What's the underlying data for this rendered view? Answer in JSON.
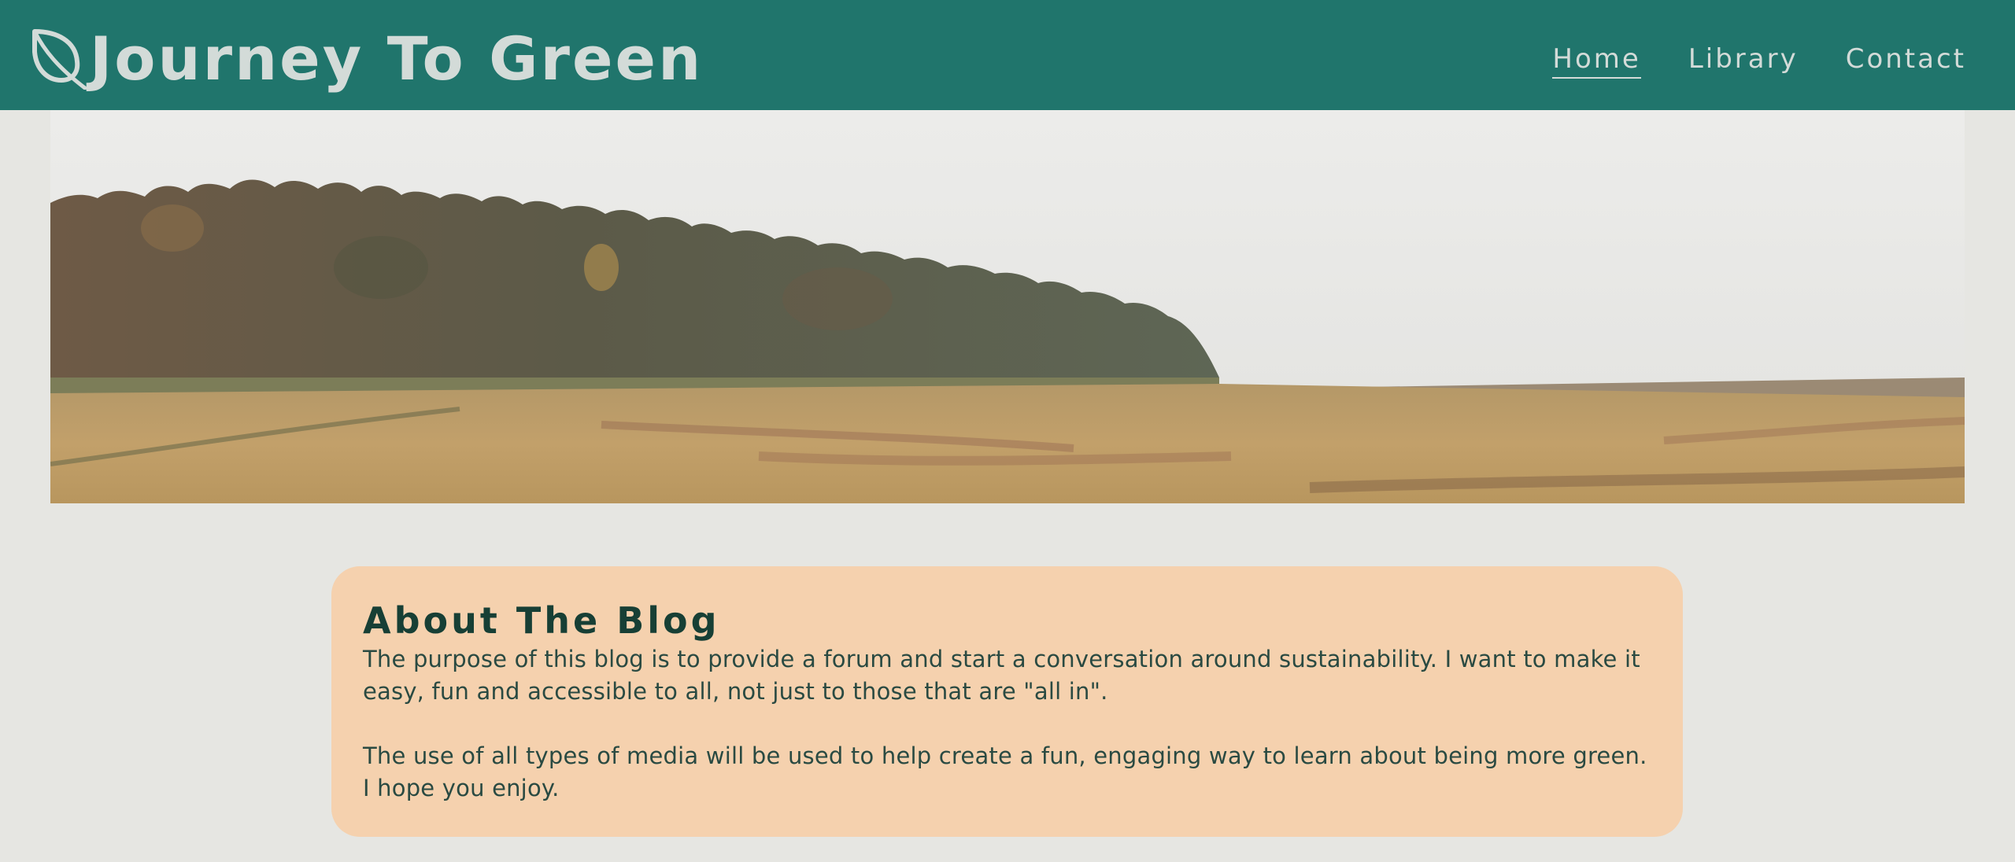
{
  "header": {
    "logo_icon": "leaf-icon",
    "title": "Journey To Green",
    "background_color": "#20756c",
    "text_color": "#d3dbd8"
  },
  "nav": {
    "items": [
      {
        "label": "Home",
        "active": true
      },
      {
        "label": "Library",
        "active": false
      },
      {
        "label": "Contact",
        "active": false
      }
    ]
  },
  "hero": {
    "image": "landscape-photo"
  },
  "about": {
    "title": "About The Blog",
    "paragraphs": [
      "The purpose of this blog is to provide a forum and start a conversation around sustainability. I want to make it easy, fun and accessible to all, not just to those that are \"all in\".",
      "The use of all types of media will be used to help create a fun, engaging way to learn about being more green. I hope you enjoy."
    ],
    "card_color": "#f5d1ae",
    "title_color": "#173f35"
  },
  "page": {
    "background_color": "#e6e6e2"
  }
}
